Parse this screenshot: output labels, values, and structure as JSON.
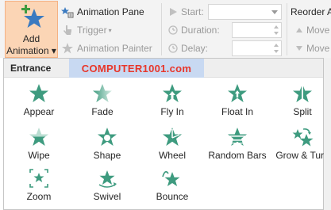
{
  "ribbon": {
    "add_animation_line1": "Add",
    "add_animation_line2": "Animation",
    "animation_pane": "Animation Pane",
    "trigger": "Trigger",
    "animation_painter": "Animation Painter",
    "start_label": "Start:",
    "duration_label": "Duration:",
    "delay_label": "Delay:",
    "start_value": "",
    "duration_value": "",
    "delay_value": "",
    "reorder_label": "Reorder A",
    "move_earlier": "Move",
    "move_later": "Move"
  },
  "panel": {
    "title": "Entrance",
    "watermark": "COMPUTER1001.com",
    "effects": [
      {
        "name": "Appear",
        "icon": "appear-icon"
      },
      {
        "name": "Fade",
        "icon": "fade-icon"
      },
      {
        "name": "Fly In",
        "icon": "fly-in-icon"
      },
      {
        "name": "Float In",
        "icon": "float-in-icon"
      },
      {
        "name": "Split",
        "icon": "split-icon"
      },
      {
        "name": "Wipe",
        "icon": "wipe-icon"
      },
      {
        "name": "Shape",
        "icon": "shape-icon"
      },
      {
        "name": "Wheel",
        "icon": "wheel-icon"
      },
      {
        "name": "Random Bars",
        "icon": "random-bars-icon"
      },
      {
        "name": "Grow & Turn",
        "icon": "grow-turn-icon"
      },
      {
        "name": "Zoom",
        "icon": "zoom-icon"
      },
      {
        "name": "Swivel",
        "icon": "swivel-icon"
      },
      {
        "name": "Bounce",
        "icon": "bounce-icon"
      }
    ]
  },
  "colors": {
    "star_green": "#3e9b7f",
    "star_blue": "#3a7ac0",
    "plus_green": "#3f9b3f",
    "button_highlight": "#fbd5b5",
    "watermark_bg": "#c8d9f2",
    "watermark_text": "#e8362a"
  }
}
